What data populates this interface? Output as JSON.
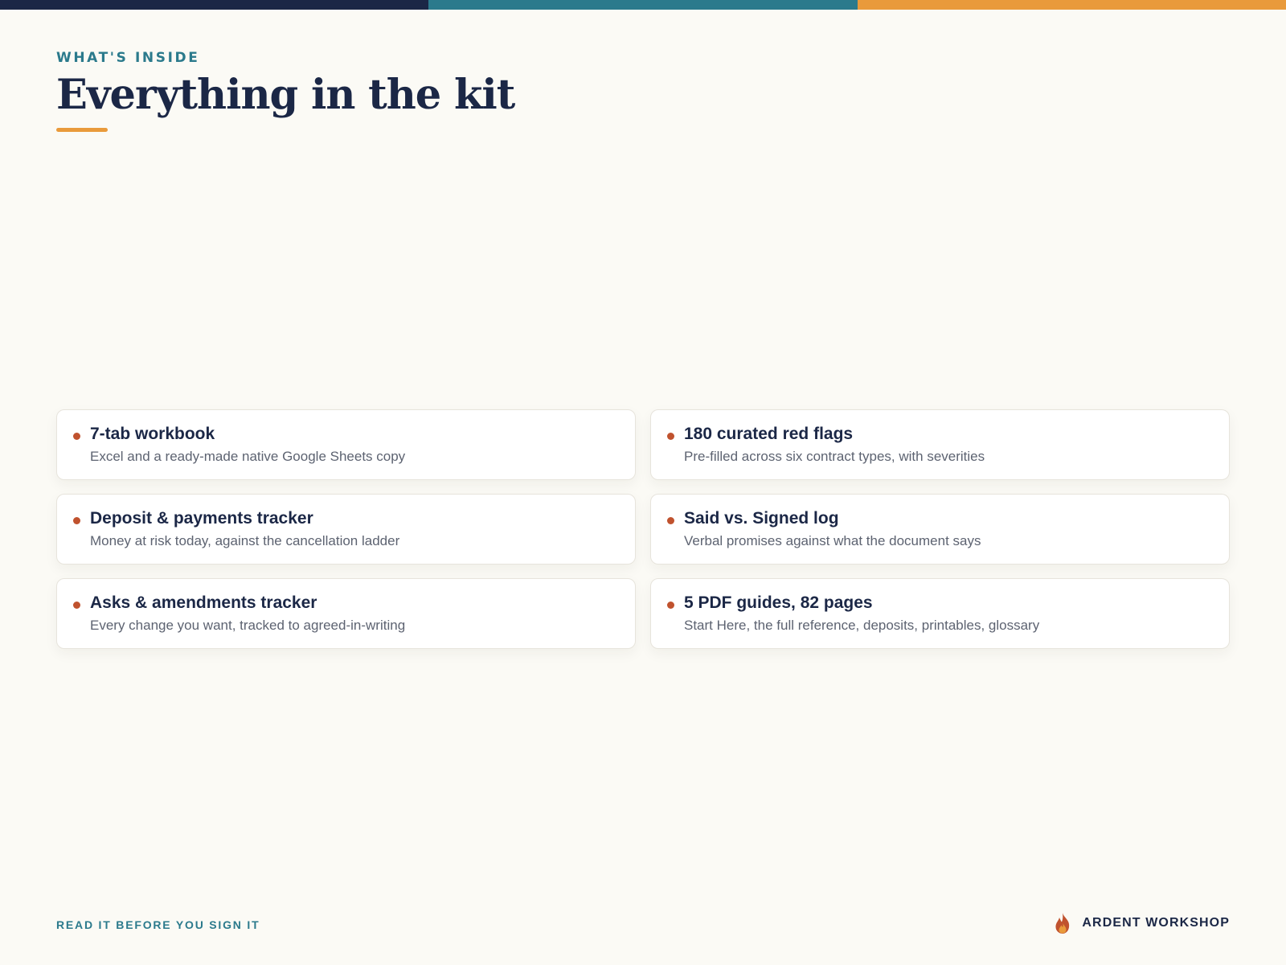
{
  "colors": {
    "navy": "#1b2746",
    "teal": "#2b7a8c",
    "amber": "#e99a3b",
    "rust": "#c0522e",
    "background": "#fbfaf5"
  },
  "header": {
    "eyebrow": "WHAT'S INSIDE",
    "title": "Everything in the kit"
  },
  "items": [
    {
      "title": "7-tab workbook",
      "description": "Excel and a ready-made native Google Sheets copy"
    },
    {
      "title": "180 curated red flags",
      "description": "Pre-filled across six contract types, with severities"
    },
    {
      "title": "Deposit & payments tracker",
      "description": "Money at risk today, against the cancellation ladder"
    },
    {
      "title": "Said vs. Signed log",
      "description": "Verbal promises against what the document says"
    },
    {
      "title": "Asks & amendments tracker",
      "description": "Every change you want, tracked to agreed-in-writing"
    },
    {
      "title": "5 PDF guides, 82 pages",
      "description": "Start Here, the full reference, deposits, printables, glossary"
    }
  ],
  "footer": {
    "tagline": "READ IT BEFORE YOU SIGN IT",
    "brand": "ARDENT WORKSHOP",
    "logo_icon": "flame-icon"
  }
}
